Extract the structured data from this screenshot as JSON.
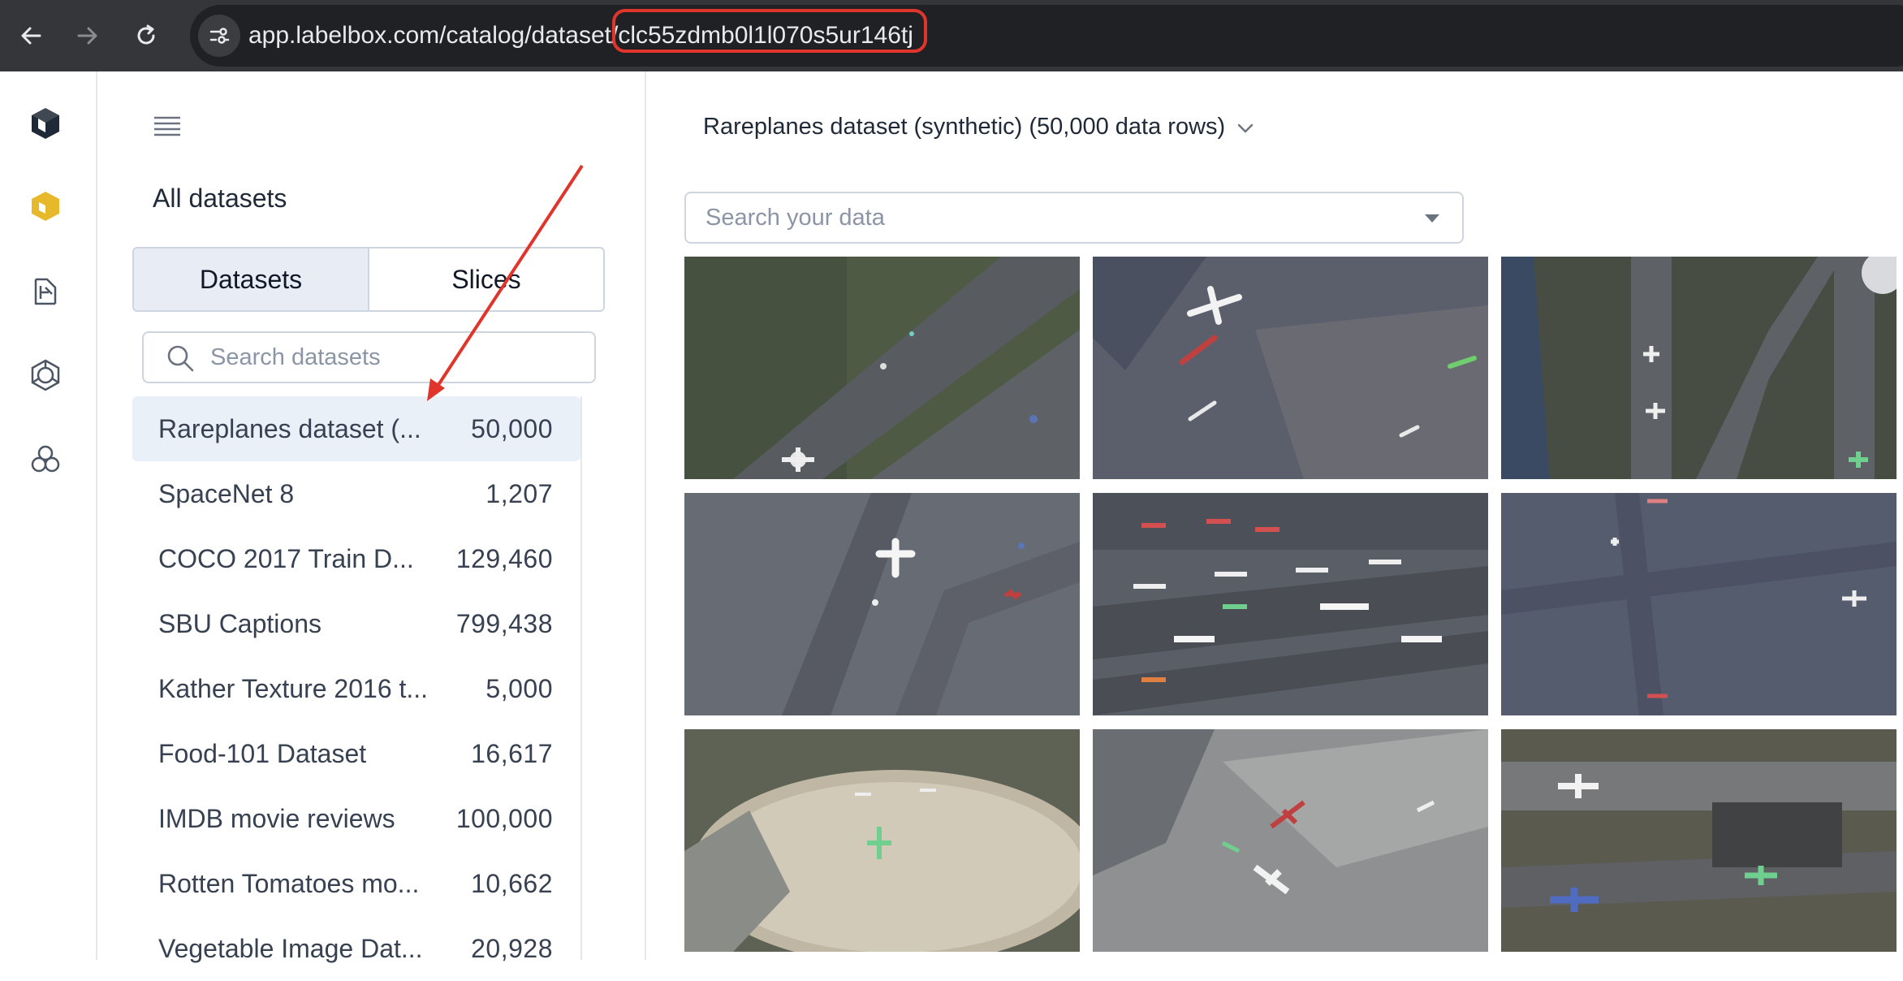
{
  "browser": {
    "url": "app.labelbox.com/catalog/dataset/clc55zdmb0l1l070s5ur146tj",
    "url_prefix": "app.labelbox.com/catalog/dataset/",
    "url_highlight": "clc55zdmb0l1l070s5ur146tj"
  },
  "rail": {
    "icons": [
      "labelbox-logo-icon",
      "catalog-icon",
      "annotate-icon",
      "model-icon",
      "workflows-icon"
    ],
    "accent": "#e7b92a"
  },
  "sidebar": {
    "heading": "All datasets",
    "tabs": [
      {
        "label": "Datasets",
        "active": true
      },
      {
        "label": "Slices",
        "active": false
      }
    ],
    "search_placeholder": "Search datasets",
    "datasets": [
      {
        "name": "Rareplanes dataset (...",
        "count": "50,000",
        "active": true
      },
      {
        "name": "SpaceNet 8",
        "count": "1,207"
      },
      {
        "name": "COCO 2017 Train D...",
        "count": "129,460"
      },
      {
        "name": "SBU Captions",
        "count": "799,438"
      },
      {
        "name": "Kather Texture 2016 t...",
        "count": "5,000"
      },
      {
        "name": "Food-101 Dataset",
        "count": "16,617"
      },
      {
        "name": "IMDB movie reviews",
        "count": "100,000"
      },
      {
        "name": "Rotten Tomatoes mo...",
        "count": "10,662"
      },
      {
        "name": "Vegetable Image Dat...",
        "count": "20,928"
      }
    ]
  },
  "main": {
    "dataset_title": "Rareplanes dataset (synthetic) (50,000 data rows)",
    "search_placeholder": "Search your data",
    "thumbnail_count": 9
  },
  "annotation": {
    "color": "#e0352b"
  }
}
